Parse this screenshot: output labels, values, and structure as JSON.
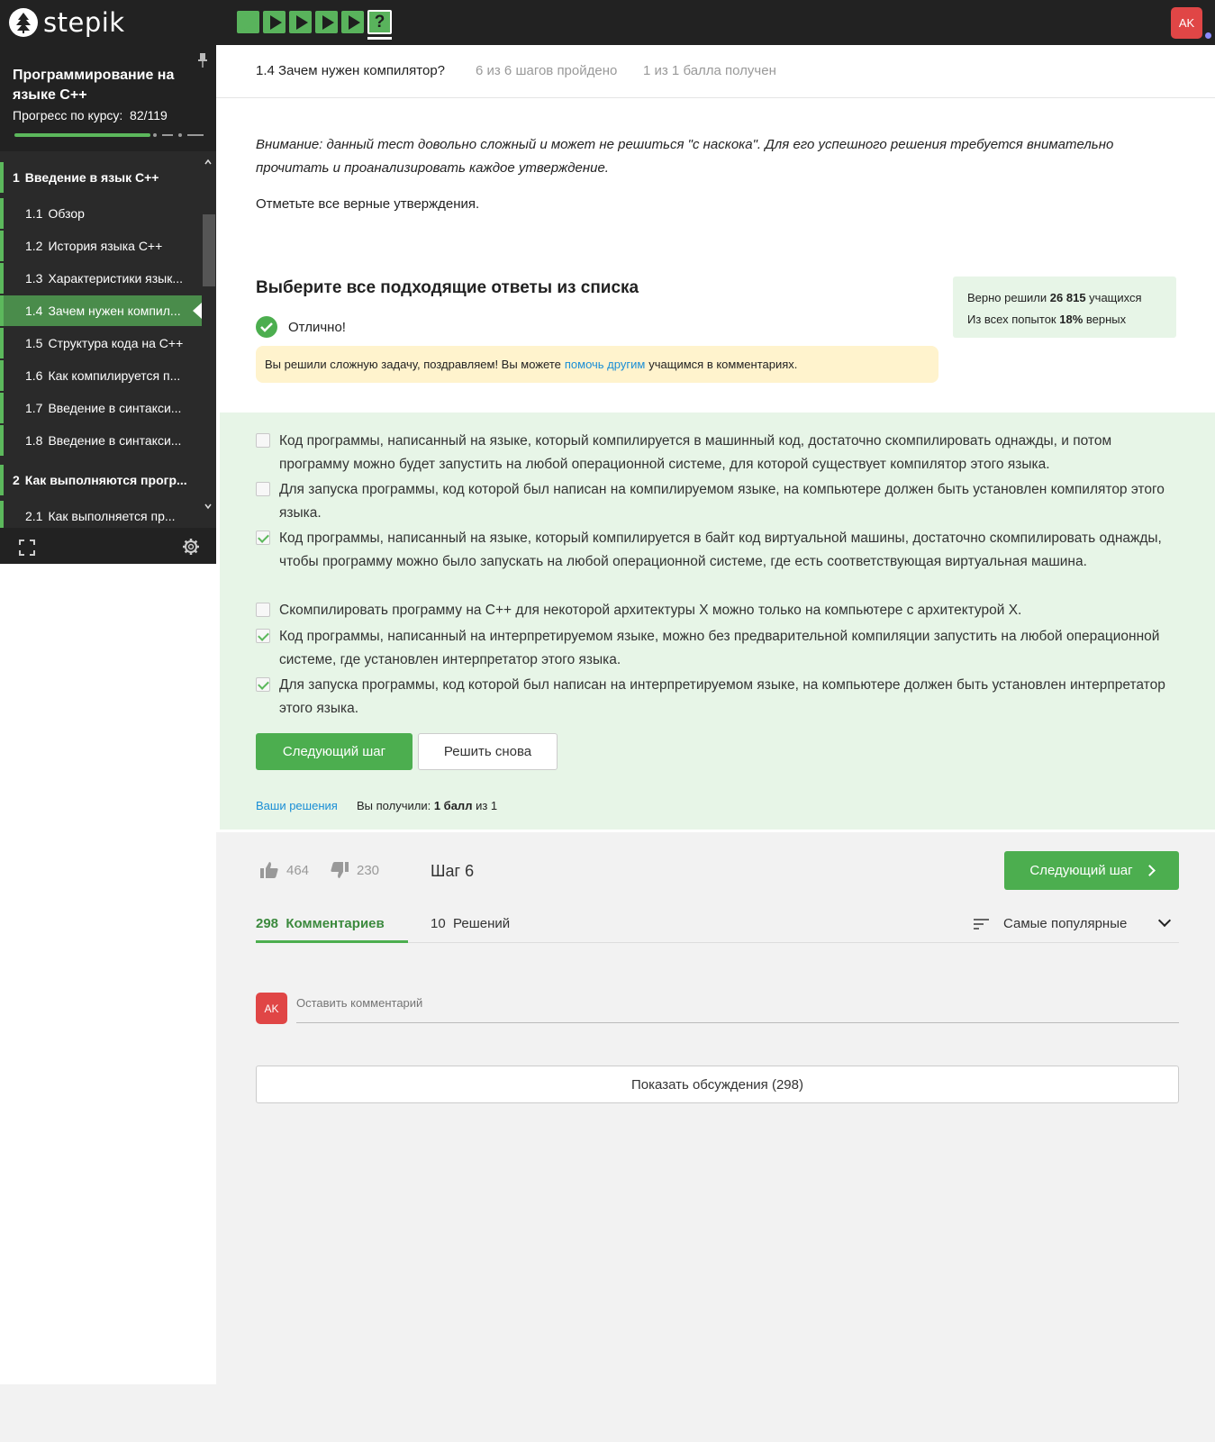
{
  "app": {
    "logo_text": "stepik"
  },
  "user": {
    "initials": "AK"
  },
  "colors": {
    "accent": "#4cae4f",
    "topbar": "#222222",
    "sidebar": "#2a2a2a",
    "success_bg": "#e7f5e7",
    "warning_bg": "#fff3cd",
    "link": "#1a8ed6",
    "avatar": "#e04646"
  },
  "step_nav": {
    "current_label": "?"
  },
  "sidebar": {
    "course_title": "Программирование на языке C++",
    "progress_label": "Прогресс по курсу:",
    "progress_value": "82/119",
    "progress_fraction": 0.689,
    "items": [
      {
        "num": "1",
        "label": "Введение в язык C++",
        "section": true
      },
      {
        "num": "1.1",
        "label": "Обзор"
      },
      {
        "num": "1.2",
        "label": "История языка C++"
      },
      {
        "num": "1.3",
        "label": "Характеристики язык..."
      },
      {
        "num": "1.4",
        "label": "Зачем нужен компил...",
        "active": true
      },
      {
        "num": "1.5",
        "label": "Структура кода на C++"
      },
      {
        "num": "1.6",
        "label": "Как компилируется п..."
      },
      {
        "num": "1.7",
        "label": "Введение в синтакси..."
      },
      {
        "num": "1.8",
        "label": "Введение в синтакси..."
      },
      {
        "num": "2",
        "label": "Как выполняются прогр...",
        "section": true
      },
      {
        "num": "2.1",
        "label": "Как выполняется пр..."
      }
    ]
  },
  "lesson": {
    "title": "1.4 Зачем нужен компилятор?",
    "steps_done": "6 из 6 шагов пройдено",
    "score": "1 из 1 балла  получен"
  },
  "task": {
    "warning": "Внимание: данный тест довольно сложный и может не решиться \"с наскока\". Для его успешного решения требуется внимательно прочитать и проанализировать каждое утверждение.",
    "instruction": "Отметьте все верные утверждения.",
    "question_title": "Выберите все подходящие ответы из списка",
    "result_text": "Отлично!",
    "congrats_before": "Вы решили сложную задачу, поздравляем! Вы можете",
    "congrats_link": "помочь другим",
    "congrats_after": "учащимся в комментариях.",
    "stats_line1_a": "Верно решили",
    "stats_line1_b": "26 815",
    "stats_line1_c": "учащихся",
    "stats_line2_a": "Из всех попыток",
    "stats_line2_b": "18%",
    "stats_line2_c": "верных",
    "options": [
      {
        "text": "Код программы, написанный на языке, который компилируется в машинный код, достаточно скомпилировать однажды, и потом программу можно будет запустить на любой операционной системе, для которой существует компилятор этого языка.",
        "checked": false
      },
      {
        "text": "Для запуска программы, код которой был написан на компилируемом языке, на компьютере должен быть установлен компилятор этого языка.",
        "checked": false
      },
      {
        "text": "Код программы, написанный на языке, который компилируется в байт код виртуальной машины, достаточно скомпилировать однажды, чтобы программу можно было запускать на любой операционной системе, где есть соответствующая виртуальная машина.",
        "checked": true
      },
      {
        "text": "Скомпилировать программу на C++ для некоторой архитектуры X можно только на компьютере с архитектурой X.",
        "checked": false
      },
      {
        "text": "Код программы, написанный на интерпретируемом языке, можно без предварительной компиляции запустить на любой операционной системе, где установлен интерпретатор этого языка.",
        "checked": true
      },
      {
        "text": "Для запуска программы, код которой был написан на интерпретируемом языке, на компьютере должен быть установлен интерпретатор этого языка.",
        "checked": true
      }
    ],
    "next_button": "Следующий шаг",
    "retry_button": "Решить снова",
    "your_solutions": "Ваши решения",
    "got_prefix": "Вы получили:",
    "got_score": "1 балл",
    "got_suffix": "из 1"
  },
  "footer": {
    "likes": "464",
    "dislikes": "230",
    "step_label": "Шаг 6",
    "next_button": "Следующий шаг"
  },
  "comments": {
    "count": "298",
    "tab_label": "Комментариев",
    "solutions_count": "10",
    "solutions_label": "Решений",
    "sort_label": "Самые популярные",
    "input_placeholder": "Оставить комментарий",
    "show_discussions": "Показать обсуждения (298)"
  }
}
